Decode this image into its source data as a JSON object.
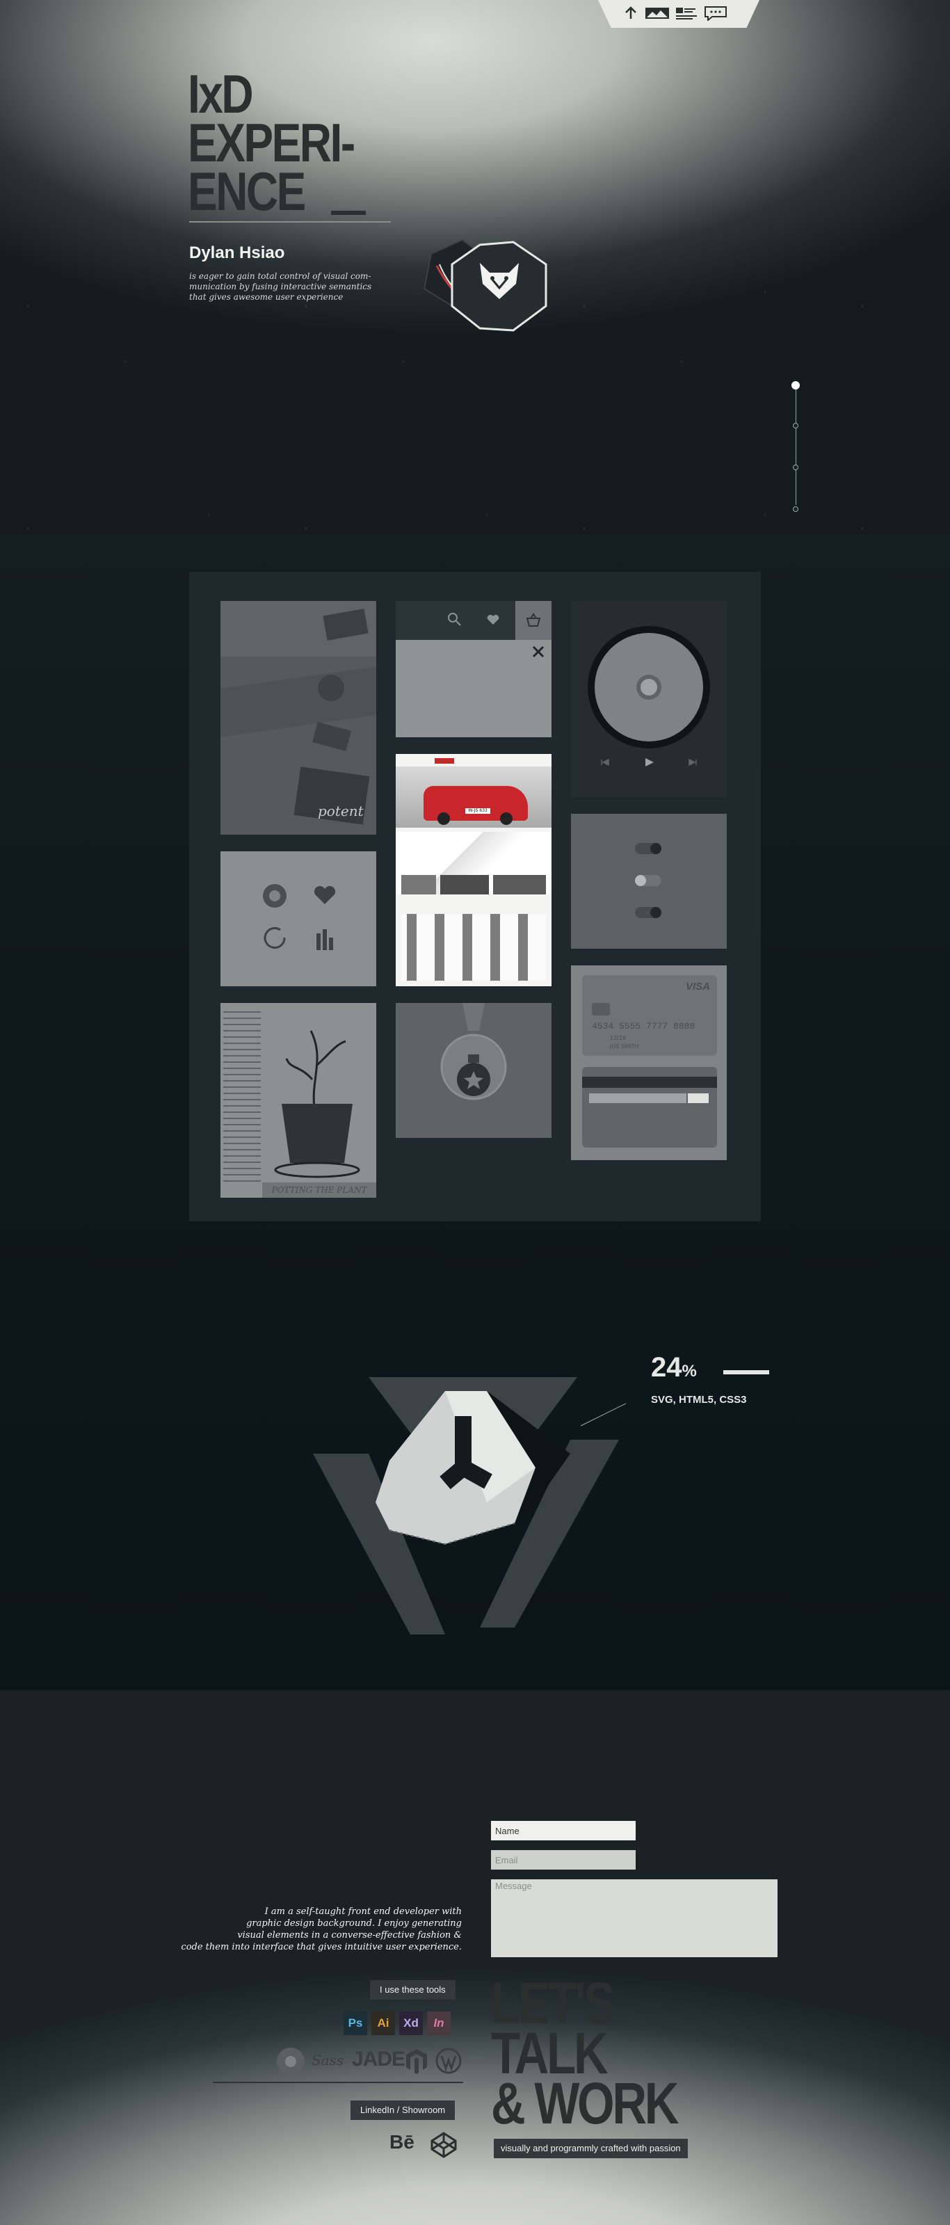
{
  "nav": {
    "items": [
      {
        "name": "arrow-up-icon"
      },
      {
        "name": "gallery-icon"
      },
      {
        "name": "profile-card-icon"
      },
      {
        "name": "chat-icon"
      }
    ]
  },
  "hero": {
    "title_lines": [
      "IxD",
      "EXPERI-",
      "ENCE"
    ],
    "author": "Dylan Hsiao",
    "tagline": "is eager to gain total control of visual com-munication by fusing interactive semantics that gives awesome user experience"
  },
  "scroll_indicator": {
    "count": 4,
    "active_index": 0
  },
  "showcase": {
    "poster_label": "potent",
    "poster_caption": "POTTING THE PLANT",
    "card_brand": "VISA",
    "card_number": "4534 5555 7777 8888",
    "card_valid": "12/18",
    "card_holder": "JOE SMITH",
    "plate": "IN-JS 633",
    "toggles": [
      "on",
      "off",
      "on"
    ]
  },
  "vector_section": {
    "percent": "24",
    "percent_unit": "%",
    "tech": "SVG, HTML5, CSS3"
  },
  "contact": {
    "name_placeholder": "Name",
    "email_placeholder": "Email",
    "message_placeholder": "Message",
    "bio_lines": [
      "I am a self-taught front end developer with",
      "graphic design background. I enjoy generating",
      "visual elements in a converse-effective fashion &",
      "code them into interface that gives intuitive user experience."
    ],
    "tools_label": "I use these tools",
    "tools_row1": [
      "Ps",
      "Ai",
      "Xd",
      "In"
    ],
    "tools_row2": [
      "Sass",
      "JADE"
    ],
    "links_label": "LinkedIn / Showroom",
    "links": [
      "Bē"
    ],
    "cta_lines": [
      "LET'S",
      "TALK",
      "& WORK"
    ],
    "cta_sub": "visually and programmly crafted with passion"
  }
}
